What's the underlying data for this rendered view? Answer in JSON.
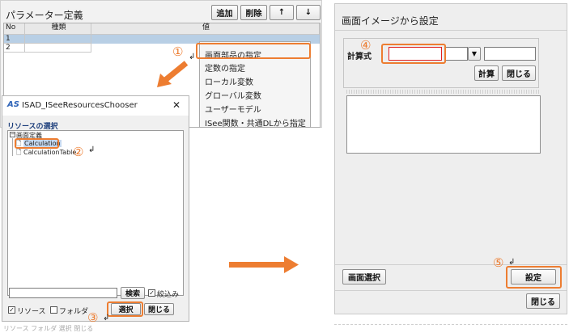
{
  "param_panel": {
    "title": "パラメーター定義",
    "buttons": {
      "add": "追加",
      "delete": "削除",
      "up": "↑",
      "down": "↓"
    },
    "columns": [
      "No",
      "種類",
      "値"
    ],
    "rows": [
      "1",
      "2"
    ]
  },
  "context_menu": {
    "items": [
      "画面部品の指定",
      "定数の指定",
      "ローカル変数",
      "グローバル変数",
      "ユーザーモデル",
      "ISee関数・共通DLから指定"
    ]
  },
  "chooser": {
    "title": "ISAD_ISeeResourcesChooser",
    "close": "✕",
    "section": "リソースの選択",
    "tree": {
      "root": "画面定義",
      "items": [
        "Calculation",
        "CalculationTable"
      ]
    },
    "search_button": "検索",
    "narrow_label": "絞込み",
    "resource_label": "リソース",
    "folder_label": "フォルダ",
    "select_button": "選択",
    "close_button": "閉じる",
    "ghost_text": "リソース フォルダ 選択 閉じる"
  },
  "screen_dialog": {
    "title": "画面イメージから設定",
    "formula_label": "計算式",
    "calc_button": "計算",
    "close_inner": "閉じる",
    "screen_select_button": "画面選択",
    "set_button": "設定",
    "close_button": "閉じる"
  },
  "steps": [
    "①",
    "②",
    "③",
    "④",
    "⑤"
  ],
  "cursor_glyph": "↲",
  "colors": {
    "accent": "#ed7d31",
    "selection": "#b8cfe5",
    "input_highlight": "#e02020"
  }
}
